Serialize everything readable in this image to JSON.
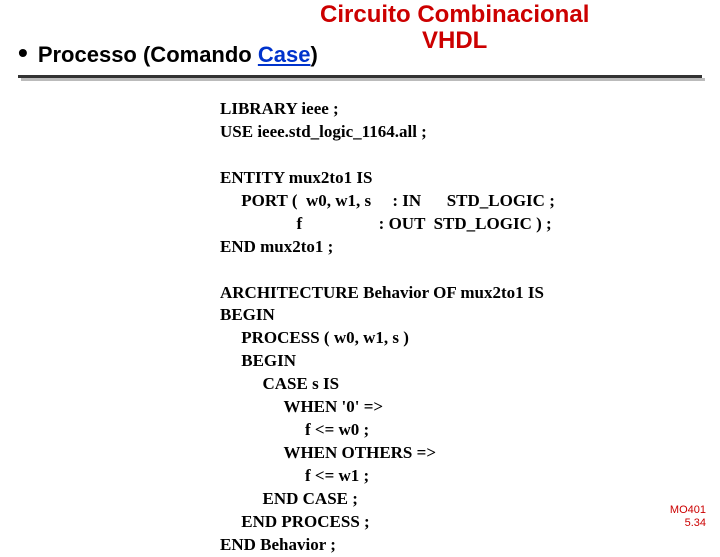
{
  "title_line1": "Circuito Combinacional",
  "title_line2": "VHDL",
  "bullet_prefix": "Processo (Comando ",
  "bullet_case": "Case",
  "bullet_suffix": ")",
  "code": "LIBRARY ieee ;\nUSE ieee.std_logic_1164.all ;\n\nENTITY mux2to1 IS\n     PORT (  w0, w1, s     : IN      STD_LOGIC ;\n                  f                  : OUT  STD_LOGIC ) ;\nEND mux2to1 ;\n\nARCHITECTURE Behavior OF mux2to1 IS\nBEGIN\n     PROCESS ( w0, w1, s )\n     BEGIN\n          CASE s IS\n               WHEN '0' =>\n                    f <= w0 ;\n               WHEN OTHERS =>\n                    f <= w1 ;\n          END CASE ;\n     END PROCESS ;\nEND Behavior ;",
  "footer_line1": "MO401",
  "footer_line2": "5.34"
}
